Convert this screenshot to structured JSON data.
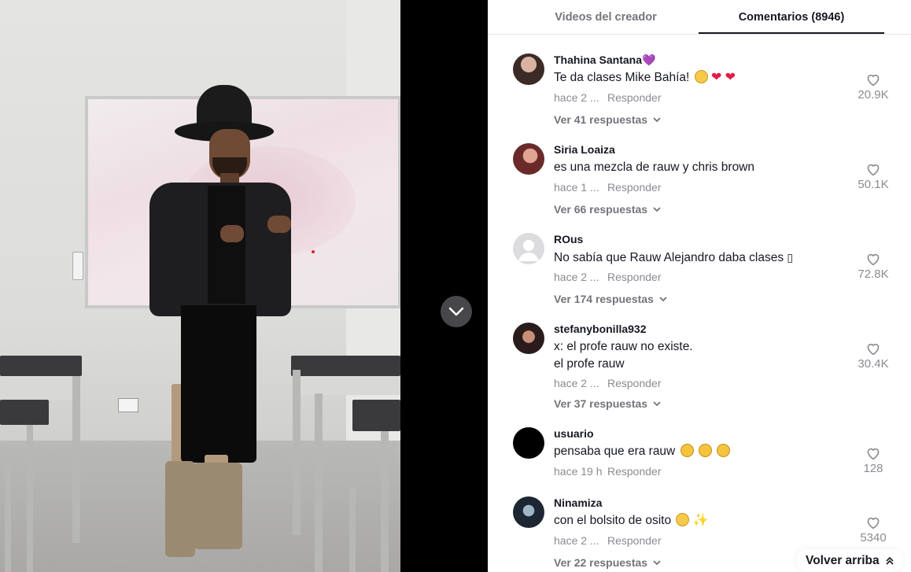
{
  "tabs": {
    "videos_label": "Videos del creador",
    "comments_label": "Comentarios (8946)"
  },
  "comments": [
    {
      "user": "Thahina Santana",
      "user_suffix": "💜",
      "text": "Te da clases Mike Bahía!",
      "emojis": [
        "smile-emoji",
        "heart",
        "heart"
      ],
      "time": "hace 2 ...",
      "reply": "Responder",
      "view_replies": "Ver 41 respuestas",
      "likes": "20.9K"
    },
    {
      "user": "Siria Loaiza",
      "text": "es una mezcla de rauw y chris brown",
      "time": "hace 1 ...",
      "reply": "Responder",
      "view_replies": "Ver 66 respuestas",
      "likes": "50.1K"
    },
    {
      "user": "ROus",
      "text": "No sabía que Rauw Alejandro daba clases",
      "text_suffix": "▯",
      "time": "hace 2 ...",
      "reply": "Responder",
      "view_replies": "Ver 174 respuestas",
      "likes": "72.8K"
    },
    {
      "user": "stefanybonilla932",
      "text_line1": "x: el profe rauw no existe.",
      "text_line2": "el profe rauw",
      "time": "hace 2 ...",
      "reply": "Responder",
      "view_replies": "Ver 37 respuestas",
      "likes": "30.4K"
    },
    {
      "user": "usuario",
      "text": "pensaba que era rauw",
      "emojis": [
        "laughing-emoji",
        "laughing-emoji",
        "laughing-emoji"
      ],
      "time": "hace 19 h",
      "reply": "Responder",
      "likes": "128"
    },
    {
      "user": "Ninamiza",
      "text": "con el bolsito de osito",
      "emojis": [
        "smile-emoji",
        "sparkles"
      ],
      "time": "hace 2 ...",
      "reply": "Responder",
      "view_replies": "Ver 22 respuestas",
      "likes": "5340"
    }
  ],
  "back_to_top": "Volver arriba",
  "icons": {
    "like": "heart-outline-icon",
    "expand": "chevron-down-icon",
    "next_video": "chevron-down-icon",
    "back_top": "double-chevron-up-icon"
  },
  "colors": {
    "primary_text": "#161823",
    "secondary_text": "#8a8b91",
    "tab_inactive": "#75767c"
  }
}
